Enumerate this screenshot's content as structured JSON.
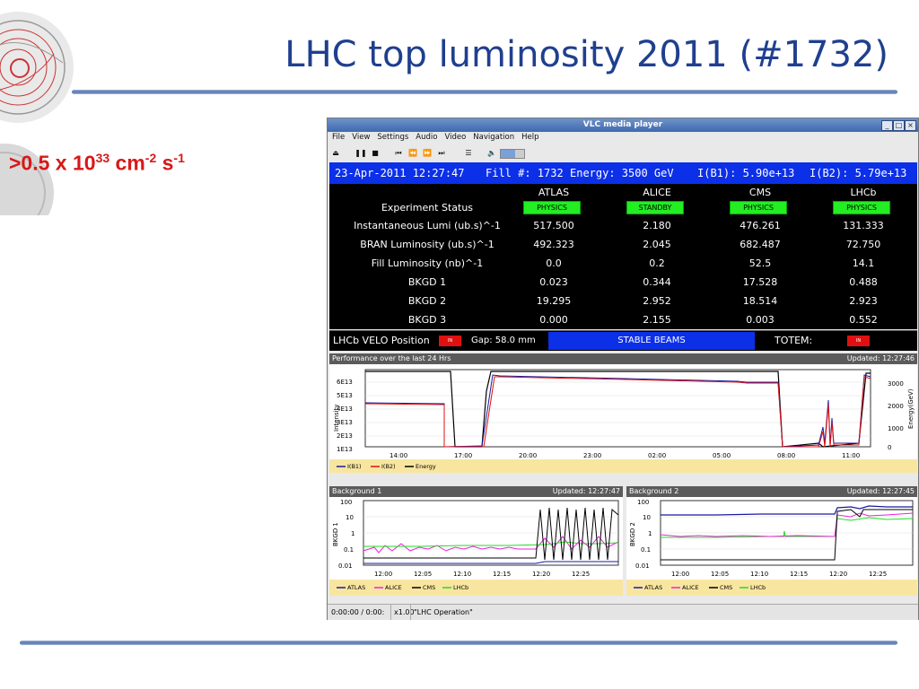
{
  "slide": {
    "title": "LHC top luminosity 2011 (#1732)",
    "subtitle": {
      "prefix": ">0.5 x 10",
      "exp1": "33",
      "mid": " cm",
      "exp2": "-2",
      "mid2": " s",
      "exp3": "-1"
    }
  },
  "window": {
    "title": "VLC media player",
    "menu": [
      "File",
      "View",
      "Settings",
      "Audio",
      "Video",
      "Navigation",
      "Help"
    ],
    "status": {
      "time": "0:00:00 / 0:00:",
      "speed": "x1.00",
      "playlist": "\"LHC Operation\""
    }
  },
  "lhc": {
    "date": "23-Apr-2011 12:27:47",
    "fill": "Fill #: 1732",
    "energy": "Energy: 3500 GeV",
    "ib1": "I(B1): 5.90e+13",
    "ib2": "I(B2): 5.79e+13",
    "experiments": [
      "ATLAS",
      "ALICE",
      "CMS",
      "LHCb"
    ],
    "status_label": "Experiment Status",
    "statuses": [
      "PHYSICS",
      "STANDBY",
      "PHYSICS",
      "PHYSICS"
    ],
    "rows": [
      {
        "label": "Instantaneous Lumi (ub.s)^-1",
        "values": [
          "517.500",
          "2.180",
          "476.261",
          "131.333"
        ]
      },
      {
        "label": "BRAN Luminosity (ub.s)^-1",
        "values": [
          "492.323",
          "2.045",
          "682.487",
          "72.750"
        ]
      },
      {
        "label": "Fill Luminosity (nb)^-1",
        "values": [
          "0.0",
          "0.2",
          "52.5",
          "14.1"
        ]
      },
      {
        "label": "BKGD 1",
        "values": [
          "0.023",
          "0.344",
          "17.528",
          "0.488"
        ]
      },
      {
        "label": "BKGD 2",
        "values": [
          "19.295",
          "2.952",
          "18.514",
          "2.923"
        ]
      },
      {
        "label": "BKGD 3",
        "values": [
          "0.000",
          "2.155",
          "0.003",
          "0.552"
        ]
      }
    ],
    "velo_label": "LHCb VELO Position",
    "velo_state": "IN",
    "gap": "Gap: 58.0 mm",
    "beam_mode": "STABLE BEAMS",
    "totem_label": "TOTEM:",
    "totem_state": "IN"
  },
  "perf": {
    "title": "Performance over the last 24 Hrs",
    "updated": "Updated: 12:27:46",
    "ylabel": "Intensity",
    "y2label": "Energy(GeV)",
    "yticks": [
      "6E13",
      "5E13",
      "4E13",
      "3E13",
      "2E13",
      "1E13"
    ],
    "y2ticks": [
      "3000",
      "2000",
      "1000",
      "0"
    ],
    "xticks": [
      "14:00",
      "17:00",
      "20:00",
      "23:00",
      "02:00",
      "05:00",
      "08:00",
      "11:00"
    ],
    "legend": [
      "I(B1)",
      "I(B2)",
      "Energy"
    ]
  },
  "bg1": {
    "title": "Background 1",
    "updated": "Updated: 12:27:47",
    "ylabel": "BKGD 1",
    "yticks": [
      "100",
      "10",
      "1",
      "0.1",
      "0.01"
    ],
    "xticks": [
      "12:00",
      "12:05",
      "12:10",
      "12:15",
      "12:20",
      "12:25"
    ],
    "legend": [
      "ATLAS",
      "ALICE",
      "CMS",
      "LHCb"
    ]
  },
  "bg2": {
    "title": "Background 2",
    "updated": "Updated: 12:27:45",
    "ylabel": "BKGD 2",
    "yticks": [
      "100",
      "10",
      "1",
      "0.1",
      "0.01"
    ],
    "xticks": [
      "12:00",
      "12:05",
      "12:10",
      "12:15",
      "12:20",
      "12:25"
    ],
    "legend": [
      "ATLAS",
      "ALICE",
      "CMS",
      "LHCb"
    ]
  },
  "colors": {
    "blue_bar": "#0c2fe8",
    "physics": "#22ee22",
    "alarm": "#e01010",
    "b1": "#1a1aa0",
    "b2": "#e01010",
    "energy": "#000000",
    "alice": "#ee22dd",
    "lhcb": "#22dd22"
  }
}
